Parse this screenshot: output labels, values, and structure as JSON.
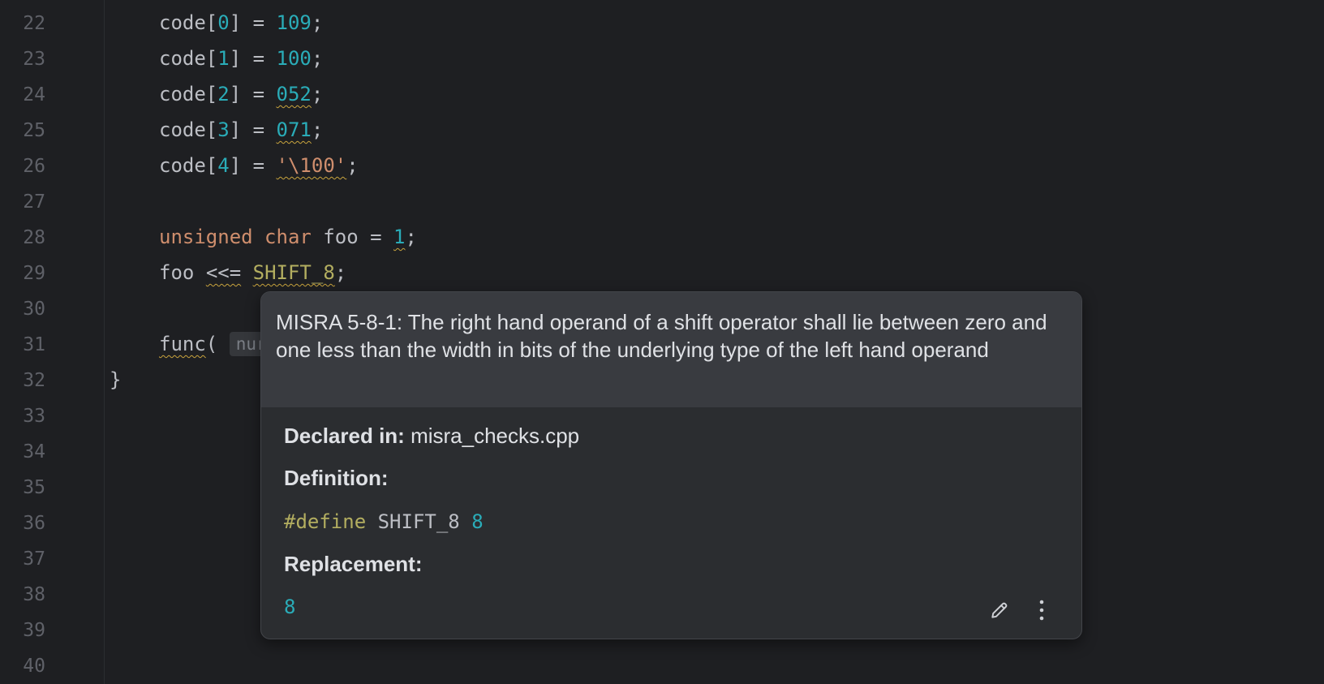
{
  "gutter": {
    "line_numbers": [
      "22",
      "23",
      "24",
      "25",
      "26",
      "27",
      "28",
      "29",
      "30",
      "31",
      "32",
      "33",
      "34",
      "35",
      "36",
      "37",
      "38",
      "39",
      "40"
    ]
  },
  "code": {
    "line22": {
      "ident": "code",
      "open": "[",
      "index": "0",
      "close": "]",
      "eq": " = ",
      "value": "109",
      "semi": ";"
    },
    "line23": {
      "ident": "code",
      "open": "[",
      "index": "1",
      "close": "]",
      "eq": " = ",
      "value": "100",
      "semi": ";"
    },
    "line24": {
      "ident": "code",
      "open": "[",
      "index": "2",
      "close": "]",
      "eq": " = ",
      "value": "052",
      "semi": ";"
    },
    "line25": {
      "ident": "code",
      "open": "[",
      "index": "3",
      "close": "]",
      "eq": " = ",
      "value": "071",
      "semi": ";"
    },
    "line26": {
      "ident": "code",
      "open": "[",
      "index": "4",
      "close": "]",
      "eq": " = ",
      "value": "'\\100'",
      "semi": ";"
    },
    "line28": {
      "kw1": "unsigned",
      "kw2": "char",
      "ident": "foo",
      "eq": " = ",
      "value": "1",
      "semi": ";"
    },
    "line29": {
      "ident": "foo",
      "op": "<<=",
      "macro": "SHIFT_8",
      "semi": ";"
    },
    "line31": {
      "func": "func",
      "paren": "(",
      "hint": "nur"
    },
    "line32": {
      "brace": "}"
    }
  },
  "popup": {
    "title": "MISRA 5-8-1: The right hand operand of a shift operator shall lie between zero and one less than the width in bits of the underlying type of the left hand operand",
    "declared_label": "Declared in:",
    "declared_value": "misra_checks.cpp",
    "definition_label": "Definition:",
    "definition_directive": "#define",
    "definition_name": "SHIFT_8",
    "definition_value": "8",
    "replacement_label": "Replacement:",
    "replacement_value": "8",
    "actions": {
      "edit_icon": "pencil-icon",
      "more_icon": "more-vertical-icon"
    }
  },
  "colors": {
    "background": "#1e1f22",
    "number": "#2aacb8",
    "keyword": "#cf8e6d",
    "string": "#6aab73",
    "macro": "#b3ae60",
    "popup_header": "#393b40",
    "popup_body": "#2b2d30"
  }
}
